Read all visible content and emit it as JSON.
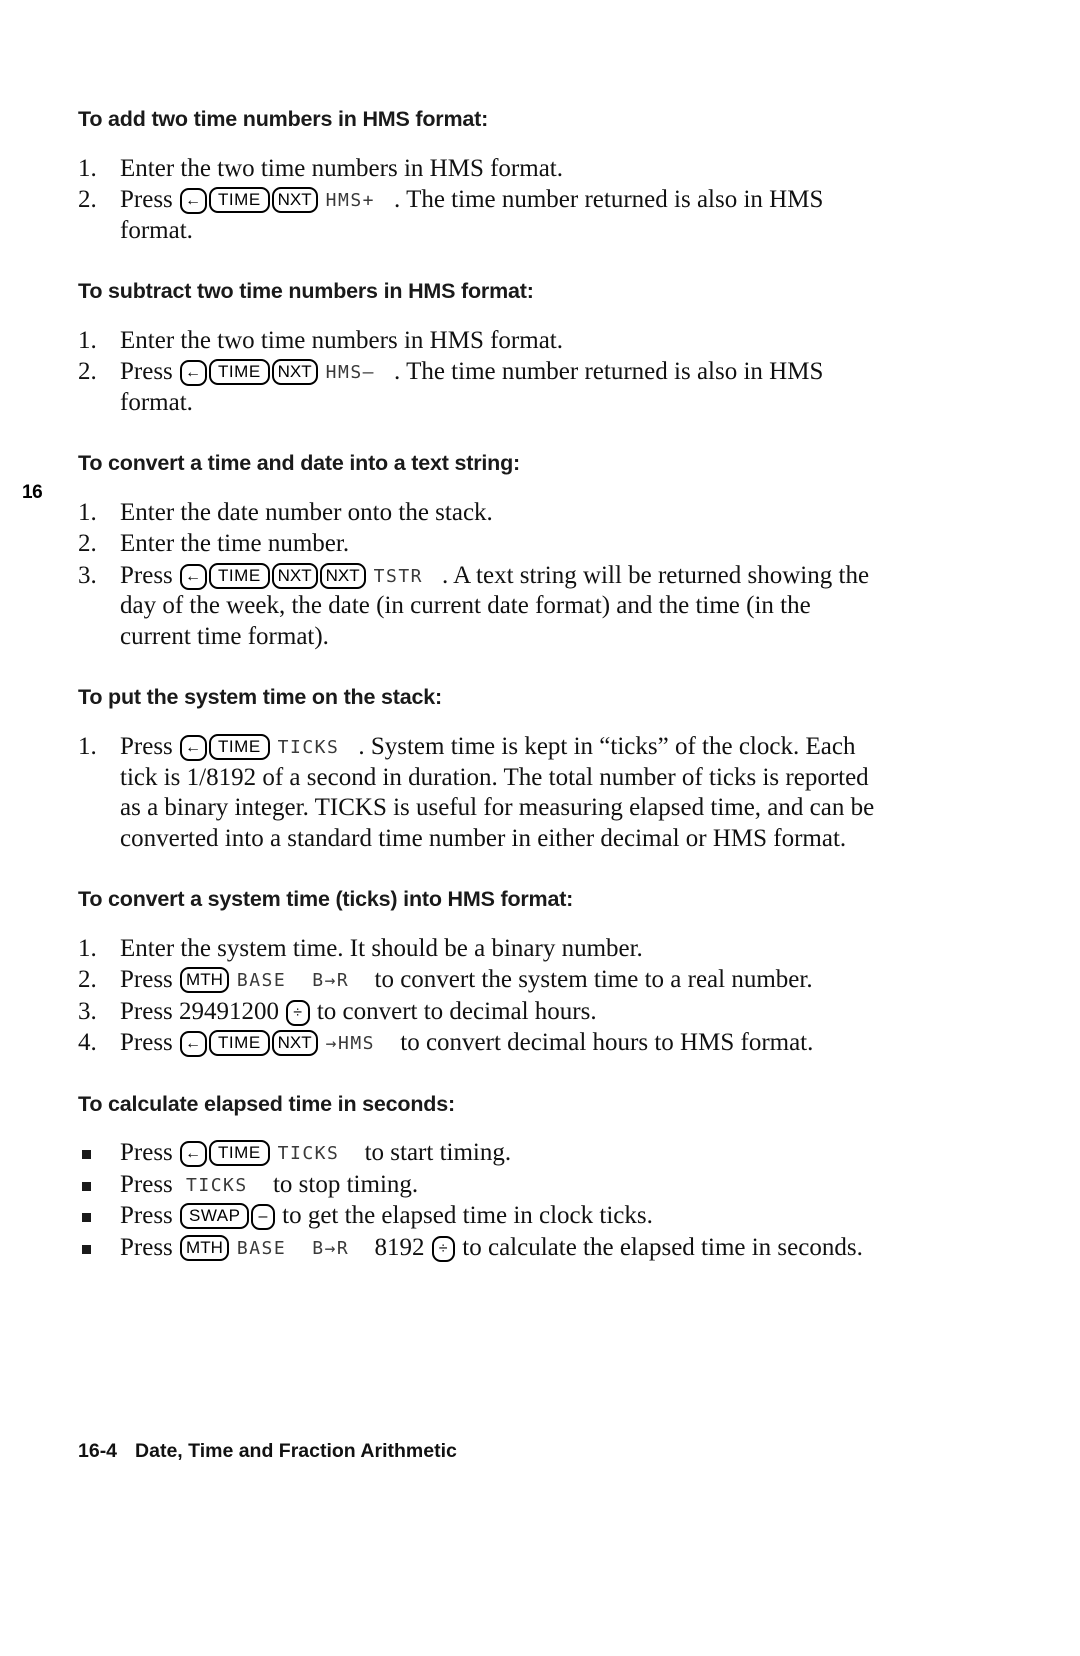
{
  "page": {
    "chapter_tab": "16",
    "footer_number": "16-4",
    "footer_title": "Date, Time and Fraction Arithmetic"
  },
  "keys": {
    "left_shift": "←",
    "time": "TIME",
    "nxt": "NXT",
    "mth": "MTH",
    "swap": "SWAP",
    "minus": "–",
    "divide": "÷"
  },
  "menu_labels": {
    "hms_plus": "HMS+",
    "hms_minus": "HMS–",
    "tstr": "TSTR",
    "ticks": "TICKS",
    "base": "BASE",
    "b_to_r": "B→R",
    "to_hms": "→HMS"
  },
  "sections": [
    {
      "heading": "To add two time numbers in HMS format:",
      "steps": [
        {
          "num": "1.",
          "parts": [
            {
              "type": "text",
              "value": "Enter the two time numbers in HMS format."
            }
          ]
        },
        {
          "num": "2.",
          "parts": [
            {
              "type": "text",
              "value": "Press "
            },
            {
              "type": "key",
              "value": "←"
            },
            {
              "type": "key",
              "value": "TIME"
            },
            {
              "type": "key",
              "value": "NXT"
            },
            {
              "type": "menu",
              "value": "HMS+"
            },
            {
              "type": "text",
              "value": ". The time number returned is also in HMS format."
            }
          ]
        }
      ]
    },
    {
      "heading": "To subtract two time numbers in HMS format:",
      "steps": [
        {
          "num": "1.",
          "parts": [
            {
              "type": "text",
              "value": "Enter the two time numbers in HMS format."
            }
          ]
        },
        {
          "num": "2.",
          "parts": [
            {
              "type": "text",
              "value": "Press "
            },
            {
              "type": "key",
              "value": "←"
            },
            {
              "type": "key",
              "value": "TIME"
            },
            {
              "type": "key",
              "value": "NXT"
            },
            {
              "type": "menu",
              "value": "HMS–"
            },
            {
              "type": "text",
              "value": ". The time number returned is also in HMS format."
            }
          ]
        }
      ]
    },
    {
      "heading": "To convert a time and date into a text string:",
      "steps": [
        {
          "num": "1.",
          "parts": [
            {
              "type": "text",
              "value": "Enter the date number onto the stack."
            }
          ]
        },
        {
          "num": "2.",
          "parts": [
            {
              "type": "text",
              "value": "Enter the time number."
            }
          ]
        },
        {
          "num": "3.",
          "parts": [
            {
              "type": "text",
              "value": "Press "
            },
            {
              "type": "key",
              "value": "←"
            },
            {
              "type": "key",
              "value": "TIME"
            },
            {
              "type": "key",
              "value": "NXT"
            },
            {
              "type": "key",
              "value": "NXT"
            },
            {
              "type": "menu",
              "value": "TSTR"
            },
            {
              "type": "text",
              "value": ". A text string will be returned showing the day of the week, the date (in current date format) and the time (in the current time format)."
            }
          ]
        }
      ]
    },
    {
      "heading": "To put the system time on the stack:",
      "steps": [
        {
          "num": "1.",
          "parts": [
            {
              "type": "text",
              "value": "Press "
            },
            {
              "type": "key",
              "value": "←"
            },
            {
              "type": "key",
              "value": "TIME"
            },
            {
              "type": "menu",
              "value": "TICKS"
            },
            {
              "type": "text",
              "value": ". System time is kept in “ticks” of the clock. Each tick is 1/8192 of a second in duration. The total number of ticks is reported as a binary integer. TICKS is useful for measuring elapsed time, and can be converted into a standard time number in either decimal or HMS format."
            }
          ]
        }
      ]
    },
    {
      "heading": "To convert a system time (ticks) into HMS format:",
      "steps": [
        {
          "num": "1.",
          "parts": [
            {
              "type": "text",
              "value": "Enter the system time. It should be a binary number."
            }
          ]
        },
        {
          "num": "2.",
          "parts": [
            {
              "type": "text",
              "value": "Press "
            },
            {
              "type": "key",
              "value": "MTH"
            },
            {
              "type": "menu",
              "value": "BASE"
            },
            {
              "type": "menu",
              "value": "B→R"
            },
            {
              "type": "text",
              "value": " to convert the system time to a real number."
            }
          ]
        },
        {
          "num": "3.",
          "parts": [
            {
              "type": "text",
              "value": "Press 29491200 "
            },
            {
              "type": "key",
              "value": "÷"
            },
            {
              "type": "text",
              "value": " to convert to decimal hours."
            }
          ]
        },
        {
          "num": "4.",
          "parts": [
            {
              "type": "text",
              "value": "Press "
            },
            {
              "type": "key",
              "value": "←"
            },
            {
              "type": "key",
              "value": "TIME"
            },
            {
              "type": "key",
              "value": "NXT"
            },
            {
              "type": "menu",
              "value": "→HMS"
            },
            {
              "type": "text",
              "value": " to convert decimal hours to HMS format."
            }
          ]
        }
      ]
    },
    {
      "heading": "To calculate elapsed time in seconds:",
      "bullets": [
        {
          "parts": [
            {
              "type": "text",
              "value": "Press "
            },
            {
              "type": "key",
              "value": "←"
            },
            {
              "type": "key",
              "value": "TIME"
            },
            {
              "type": "menu",
              "value": "TICKS"
            },
            {
              "type": "text",
              "value": " to start timing."
            }
          ]
        },
        {
          "parts": [
            {
              "type": "text",
              "value": "Press "
            },
            {
              "type": "menu",
              "value": "TICKS"
            },
            {
              "type": "text",
              "value": " to stop timing."
            }
          ]
        },
        {
          "parts": [
            {
              "type": "text",
              "value": "Press "
            },
            {
              "type": "key",
              "value": "SWAP"
            },
            {
              "type": "key",
              "value": "–"
            },
            {
              "type": "text",
              "value": " to get the elapsed time in clock ticks."
            }
          ]
        },
        {
          "parts": [
            {
              "type": "text",
              "value": "Press "
            },
            {
              "type": "key",
              "value": "MTH"
            },
            {
              "type": "menu",
              "value": "BASE"
            },
            {
              "type": "menu",
              "value": "B→R"
            },
            {
              "type": "text",
              "value": " 8192 "
            },
            {
              "type": "key",
              "value": "÷"
            },
            {
              "type": "text",
              "value": " to calculate the elapsed time in seconds."
            }
          ]
        }
      ]
    }
  ]
}
